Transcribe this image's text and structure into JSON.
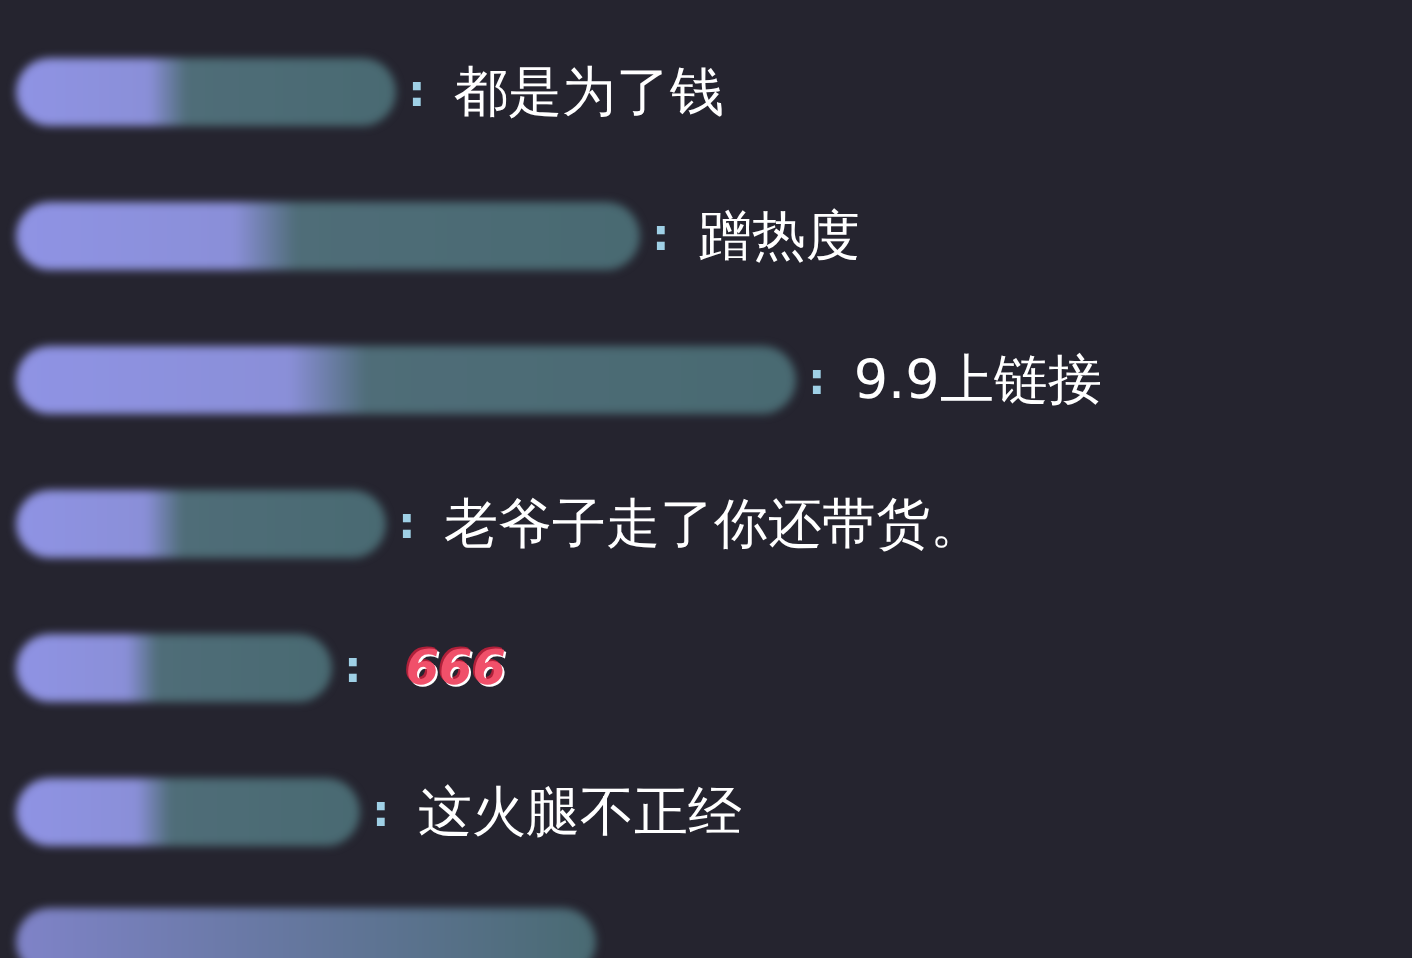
{
  "chat": {
    "messages": [
      {
        "kind": "text",
        "separator": ":",
        "text": "都是为了钱"
      },
      {
        "kind": "text",
        "separator": ":",
        "text": "蹭热度"
      },
      {
        "kind": "text",
        "separator": ":",
        "text": "9.9上链接"
      },
      {
        "kind": "text",
        "separator": ":",
        "text": "老爷子走了你还带货。"
      },
      {
        "kind": "sticker",
        "separator": ":",
        "text": "666"
      },
      {
        "kind": "text",
        "separator": ":",
        "text": "这火腿不正经"
      }
    ]
  }
}
